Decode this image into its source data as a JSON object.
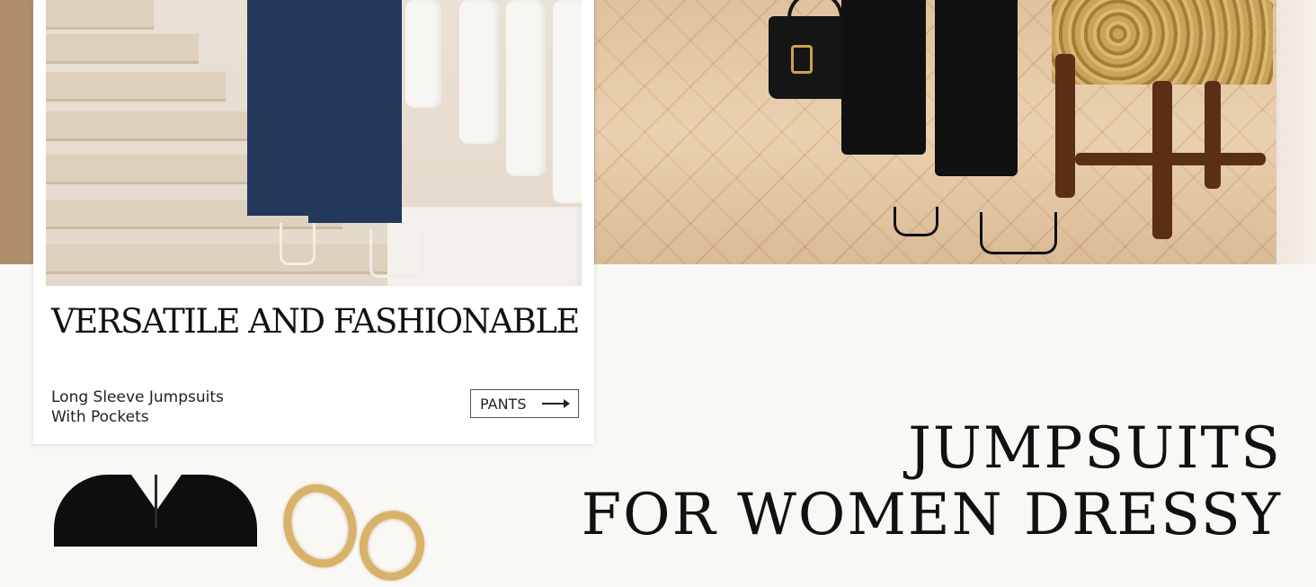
{
  "card": {
    "title": "VERSATILE AND FASHIONABLE",
    "subtitle_line1": "Long Sleeve Jumpsuits",
    "subtitle_line2": "With Pockets",
    "button_label": "PANTS"
  },
  "heading": {
    "line1": "JUMPSUITS",
    "line2": "FOR WOMEN DRESSY"
  },
  "images": {
    "card_photo": "model in navy wide-leg jumpsuit on white staircase",
    "hero_photo": "model in black jumpsuit with handbag beside ornate chair",
    "product_1": "black v-neck dress",
    "product_2": "gold hoop earrings"
  },
  "colors": {
    "navy": "#23385a",
    "gold": "#d9b269",
    "background": "#faf8f5"
  }
}
